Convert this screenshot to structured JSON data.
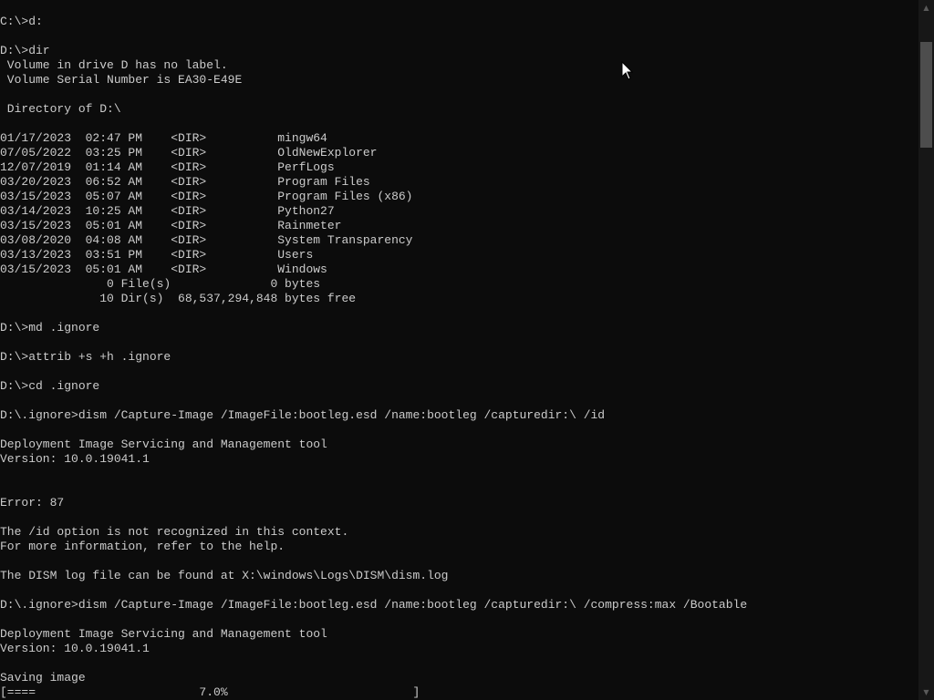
{
  "console": {
    "lines": [
      "C:\\>d:",
      "",
      "D:\\>dir",
      " Volume in drive D has no label.",
      " Volume Serial Number is EA30-E49E",
      "",
      " Directory of D:\\",
      "",
      "01/17/2023  02:47 PM    <DIR>          mingw64",
      "07/05/2022  03:25 PM    <DIR>          OldNewExplorer",
      "12/07/2019  01:14 AM    <DIR>          PerfLogs",
      "03/20/2023  06:52 AM    <DIR>          Program Files",
      "03/15/2023  05:07 AM    <DIR>          Program Files (x86)",
      "03/14/2023  10:25 AM    <DIR>          Python27",
      "03/15/2023  05:01 AM    <DIR>          Rainmeter",
      "03/08/2020  04:08 AM    <DIR>          System Transparency",
      "03/13/2023  03:51 PM    <DIR>          Users",
      "03/15/2023  05:01 AM    <DIR>          Windows",
      "               0 File(s)              0 bytes",
      "              10 Dir(s)  68,537,294,848 bytes free",
      "",
      "D:\\>md .ignore",
      "",
      "D:\\>attrib +s +h .ignore",
      "",
      "D:\\>cd .ignore",
      "",
      "D:\\.ignore>dism /Capture-Image /ImageFile:bootleg.esd /name:bootleg /capturedir:\\ /id",
      "",
      "Deployment Image Servicing and Management tool",
      "Version: 10.0.19041.1",
      "",
      "",
      "Error: 87",
      "",
      "The /id option is not recognized in this context.",
      "For more information, refer to the help.",
      "",
      "The DISM log file can be found at X:\\windows\\Logs\\DISM\\dism.log",
      "",
      "D:\\.ignore>dism /Capture-Image /ImageFile:bootleg.esd /name:bootleg /capturedir:\\ /compress:max /Bootable",
      "",
      "Deployment Image Servicing and Management tool",
      "Version: 10.0.19041.1",
      "",
      "Saving image",
      "[====                       7.0%                          ]"
    ]
  },
  "colors": {
    "background": "#0c0c0c",
    "text": "#cccccc",
    "scrollbar_track": "#171717",
    "scrollbar_thumb": "#4d4d4d"
  },
  "icons": {
    "scroll_up": "scroll-up-arrow-icon",
    "scroll_down": "scroll-down-arrow-icon",
    "pointer": "mouse-pointer-icon"
  },
  "progress": {
    "percent": 7.0
  }
}
